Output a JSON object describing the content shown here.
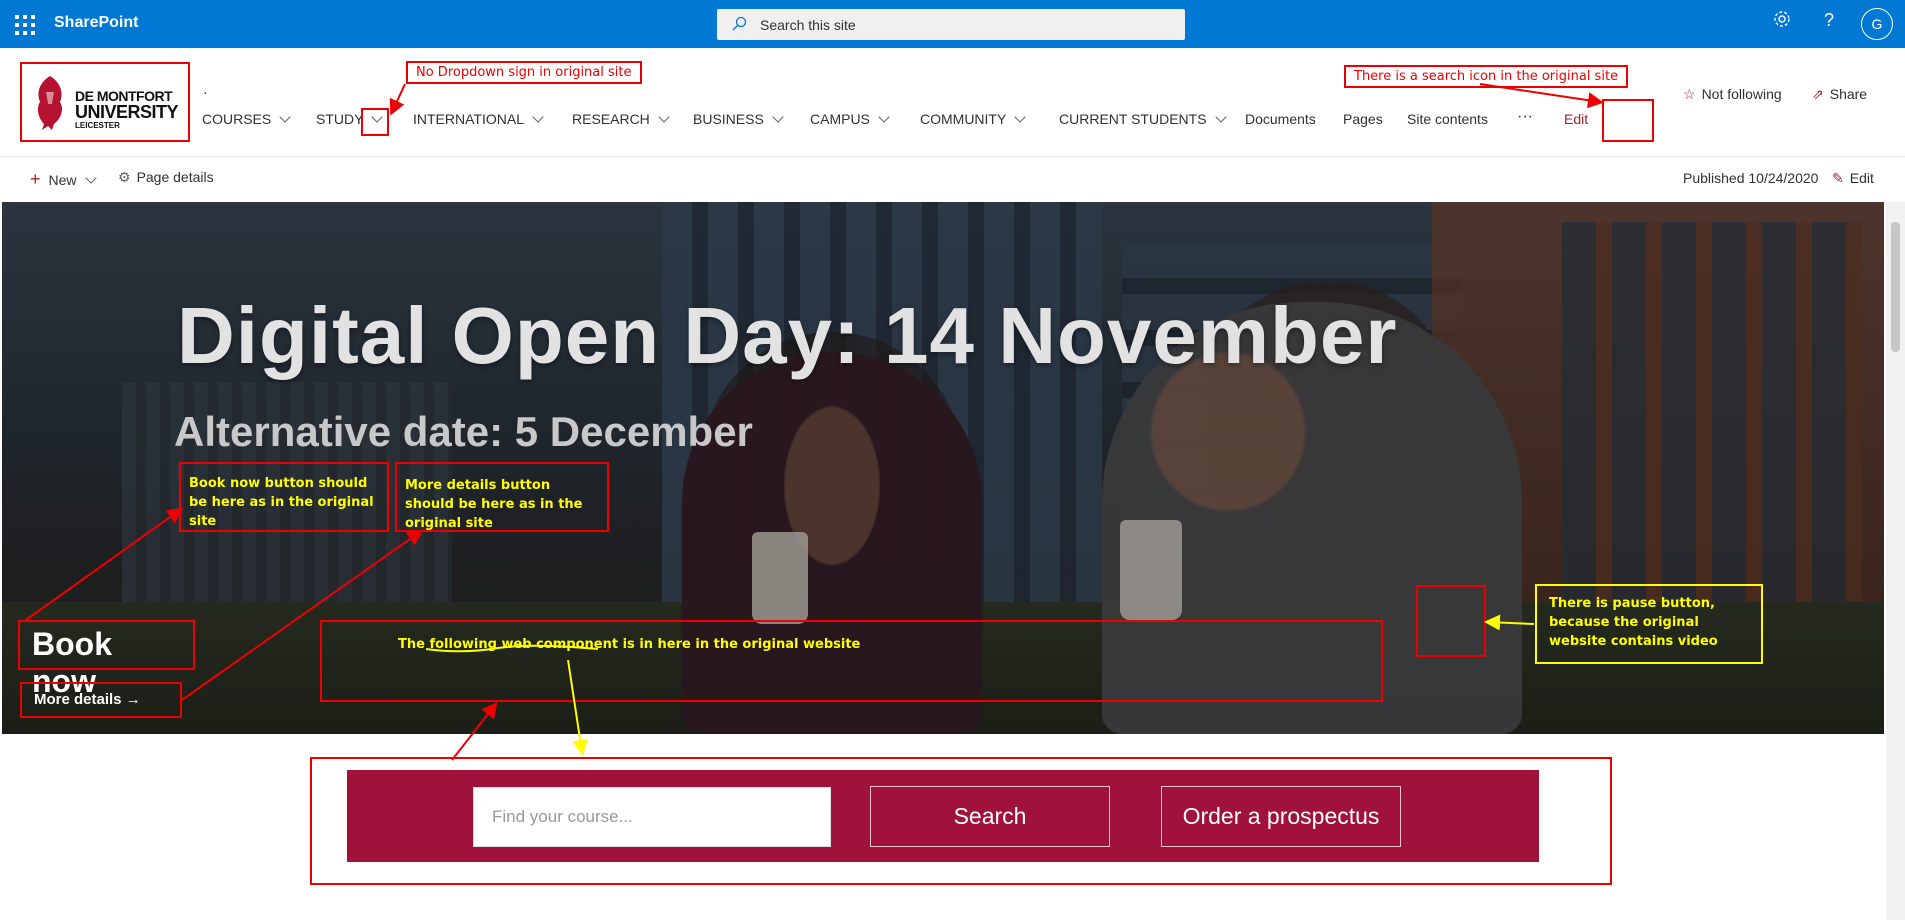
{
  "suite_bar": {
    "app_name": "SharePoint",
    "search_placeholder": "Search this site",
    "avatar_initial": "G",
    "settings_icon": "gear-icon",
    "help_icon": "question-icon"
  },
  "site_header": {
    "logo": {
      "line1": "DE MONTFORT",
      "line2": "UNIVERSITY",
      "line3": "LEICESTER"
    },
    "dot": "·",
    "nav_items": [
      {
        "label": "COURSES",
        "dropdown": true
      },
      {
        "label": "STUDY",
        "dropdown": true
      },
      {
        "label": "INTERNATIONAL",
        "dropdown": true
      },
      {
        "label": "RESEARCH",
        "dropdown": true
      },
      {
        "label": "BUSINESS",
        "dropdown": true
      },
      {
        "label": "CAMPUS",
        "dropdown": true
      },
      {
        "label": "COMMUNITY",
        "dropdown": true
      },
      {
        "label": "CURRENT STUDENTS",
        "dropdown": true
      },
      {
        "label": "Documents",
        "dropdown": false
      },
      {
        "label": "Pages",
        "dropdown": false
      },
      {
        "label": "Site contents",
        "dropdown": false
      }
    ],
    "more_label": "···",
    "edit_label": "Edit",
    "follow_label": "Not following",
    "share_label": "Share"
  },
  "command_bar": {
    "new_label": "New",
    "page_details_label": "Page details",
    "published_label": "Published 10/24/2020",
    "edit_label": "Edit"
  },
  "hero": {
    "title": "Digital Open Day: 14 November",
    "subtitle": "Alternative date: 5 December",
    "book_now": "Book now",
    "more_details": "More details →"
  },
  "annotations": {
    "no_dropdown": "No Dropdown sign in original site",
    "search_icon": "There is a search icon in the original site",
    "book_now_note": "Book now button should be here as in the original site",
    "more_details_note": "More details button should be here as in the original site",
    "component_note": "The following web component is in here in the original website",
    "pause_note": "There is pause button, because the original website contains video"
  },
  "course_component": {
    "find_placeholder": "Find your course...",
    "search_label": "Search",
    "prospectus_label": "Order a prospectus",
    "brand_color": "#a0123b"
  },
  "colors": {
    "suite": "#0078d4",
    "annotation_red": "#ee0000",
    "annotation_yellow": "#ffff00"
  }
}
